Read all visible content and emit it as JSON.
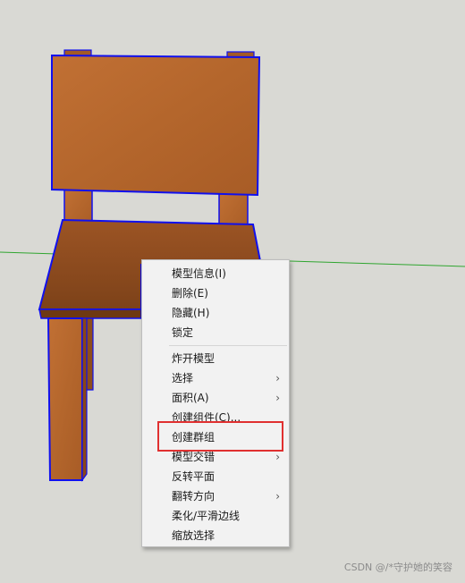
{
  "context_menu": {
    "group1": [
      {
        "label": "模型信息(I)",
        "submenu": false
      },
      {
        "label": "删除(E)",
        "submenu": false
      },
      {
        "label": "隐藏(H)",
        "submenu": false
      },
      {
        "label": "锁定",
        "submenu": false
      }
    ],
    "group2": [
      {
        "label": "炸开模型",
        "submenu": false
      },
      {
        "label": "选择",
        "submenu": true
      },
      {
        "label": "面积(A)",
        "submenu": true
      },
      {
        "label": "创建组件(C)...",
        "submenu": false
      },
      {
        "label": "创建群组",
        "submenu": false
      },
      {
        "label": "模型交错",
        "submenu": true
      },
      {
        "label": "反转平面",
        "submenu": false
      },
      {
        "label": "翻转方向",
        "submenu": true
      },
      {
        "label": "柔化/平滑边线",
        "submenu": false
      },
      {
        "label": "缩放选择",
        "submenu": false
      }
    ],
    "submenu_arrow": "›"
  },
  "highlighted_item": "创建群组",
  "watermark": "CSDN @/*守护她的笑容",
  "colors": {
    "background": "#d9d9d4",
    "wood": "#b8672c",
    "wood_dark": "#8a4717",
    "selection_edge": "#1010ee",
    "axis_green": "#2fa52f",
    "highlight_box": "#e03030"
  }
}
